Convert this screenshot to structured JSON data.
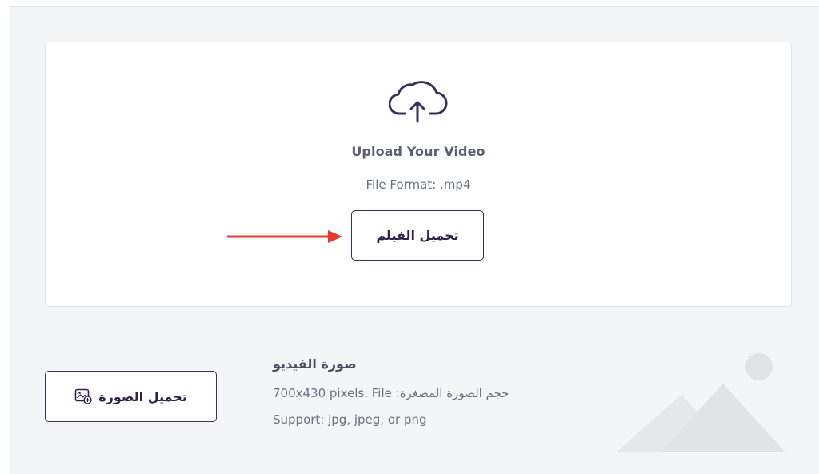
{
  "video_upload": {
    "title": "Upload Your Video",
    "format_text": "File Format: .mp4",
    "button_label": "تحميل الفيلم",
    "icon": "cloud-upload-icon"
  },
  "thumbnail": {
    "title": "صورة الفيديو",
    "size_text": "700x430 pixels. File :حجم الصورة المصغرة",
    "support_text": "Support: jpg, jpeg, or png",
    "button_label": "تحميل الصورة",
    "button_icon": "image-add-icon",
    "placeholder_icon": "mountain-placeholder-icon"
  },
  "annotation": {
    "arrow_color": "#e8392b"
  },
  "colors": {
    "accent": "#3d2d5a",
    "panel_bg": "#f3f5f7",
    "placeholder": "#e1e3e6"
  }
}
